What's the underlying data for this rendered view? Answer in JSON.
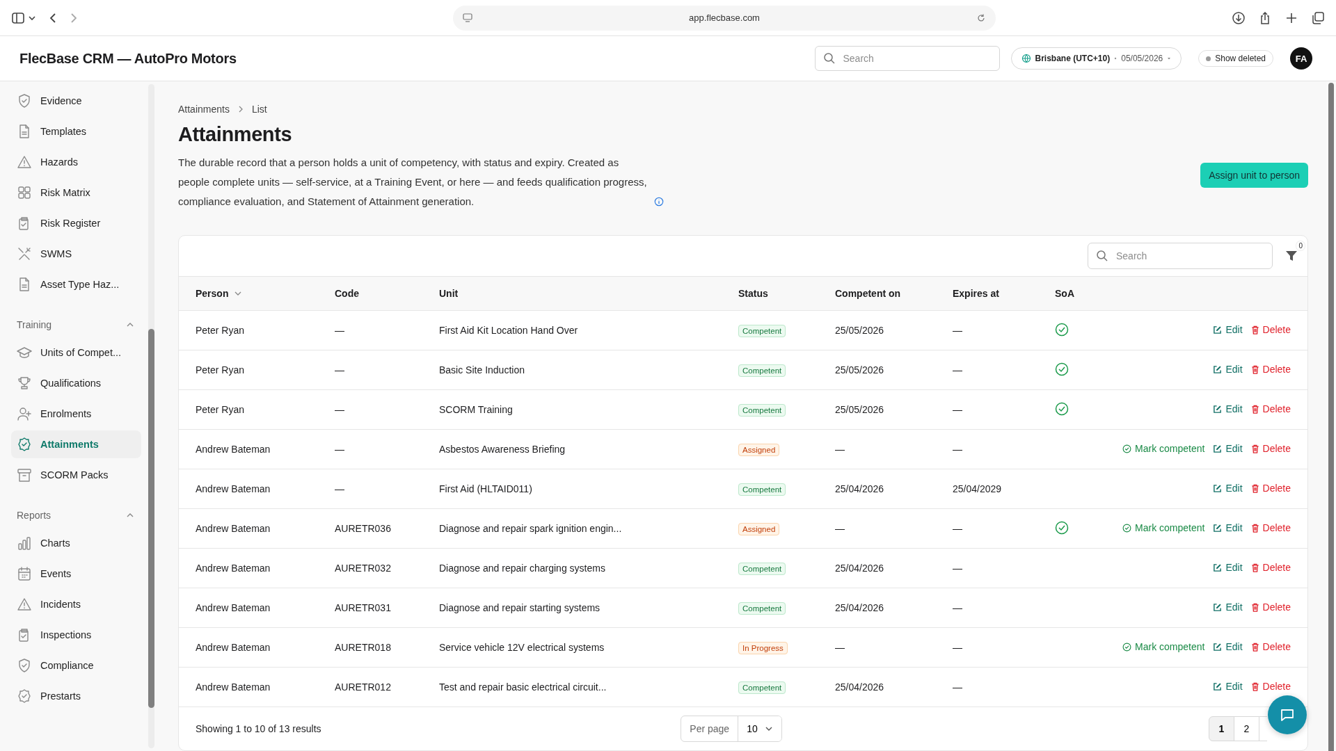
{
  "browser": {
    "url": "app.flecbase.com"
  },
  "header": {
    "title": "FlecBase CRM — AutoPro Motors",
    "search": {
      "placeholder": "Search"
    },
    "timezone": "Brisbane (UTC+10)",
    "date": "05/05/2026",
    "show_deleted": {
      "label": "Show deleted",
      "on": false
    },
    "avatar": "FA"
  },
  "sidebar": {
    "groups": [
      {
        "items": [
          {
            "label": "Evidence",
            "selected": false
          },
          {
            "label": "Templates",
            "selected": false
          },
          {
            "label": "Hazards",
            "selected": false
          },
          {
            "label": "Risk Matrix",
            "selected": false
          },
          {
            "label": "Risk Register",
            "selected": false
          },
          {
            "label": "SWMS",
            "selected": false
          },
          {
            "label": "Asset Type Haz...",
            "selected": false
          }
        ]
      },
      {
        "title": "Training",
        "expanded": true,
        "items": [
          {
            "label": "Units of Compet...",
            "selected": false
          },
          {
            "label": "Qualifications",
            "selected": false
          },
          {
            "label": "Enrolments",
            "selected": false
          },
          {
            "label": "Attainments",
            "selected": true
          },
          {
            "label": "SCORM Packs",
            "selected": false
          }
        ]
      },
      {
        "title": "Reports",
        "expanded": true,
        "items": [
          {
            "label": "Charts",
            "selected": false
          },
          {
            "label": "Events",
            "selected": false
          },
          {
            "label": "Incidents",
            "selected": false
          },
          {
            "label": "Inspections",
            "selected": false
          },
          {
            "label": "Compliance",
            "selected": false
          },
          {
            "label": "Prestarts",
            "selected": false
          }
        ]
      }
    ]
  },
  "breadcrumb": [
    "Attainments",
    "List"
  ],
  "page": {
    "title": "Attainments",
    "description": "The durable record that a person holds a unit of competency, with status and expiry. Created as people complete units — self-service, at a Training Event, or here — and feeds qualification progress, compliance evaluation, and Statement of Attainment generation.",
    "primary_button": "Assign unit to person"
  },
  "table": {
    "search": {
      "placeholder": "Search"
    },
    "filter_count": "0",
    "columns": [
      "Person",
      "Code",
      "Unit",
      "Status",
      "Competent on",
      "Expires at",
      "SoA"
    ],
    "rows": [
      {
        "person": "Peter Ryan",
        "code": "—",
        "unit": "First Aid Kit Location Hand Over",
        "status": {
          "label": "Competent",
          "kind": "competent"
        },
        "competent_on": "25/05/2026",
        "expires_at": "—",
        "soa": true,
        "actions": [
          {
            "kind": "edit",
            "label": "Edit"
          },
          {
            "kind": "delete",
            "label": "Delete"
          }
        ]
      },
      {
        "person": "Peter Ryan",
        "code": "—",
        "unit": "Basic Site Induction",
        "status": {
          "label": "Competent",
          "kind": "competent"
        },
        "competent_on": "25/05/2026",
        "expires_at": "—",
        "soa": true,
        "actions": [
          {
            "kind": "edit",
            "label": "Edit"
          },
          {
            "kind": "delete",
            "label": "Delete"
          }
        ]
      },
      {
        "person": "Peter Ryan",
        "code": "—",
        "unit": "SCORM Training",
        "status": {
          "label": "Competent",
          "kind": "competent"
        },
        "competent_on": "25/05/2026",
        "expires_at": "—",
        "soa": true,
        "actions": [
          {
            "kind": "edit",
            "label": "Edit"
          },
          {
            "kind": "delete",
            "label": "Delete"
          }
        ]
      },
      {
        "person": "Andrew Bateman",
        "code": "—",
        "unit": "Asbestos Awareness Briefing",
        "status": {
          "label": "Assigned",
          "kind": "pending"
        },
        "competent_on": "—",
        "expires_at": "—",
        "soa": false,
        "actions": [
          {
            "kind": "mark",
            "label": "Mark competent"
          },
          {
            "kind": "edit",
            "label": "Edit"
          },
          {
            "kind": "delete",
            "label": "Delete"
          }
        ]
      },
      {
        "person": "Andrew Bateman",
        "code": "—",
        "unit": "First Aid (HLTAID011)",
        "status": {
          "label": "Competent",
          "kind": "competent"
        },
        "competent_on": "25/04/2026",
        "expires_at": "25/04/2029",
        "soa": false,
        "actions": [
          {
            "kind": "edit",
            "label": "Edit"
          },
          {
            "kind": "delete",
            "label": "Delete"
          }
        ]
      },
      {
        "person": "Andrew Bateman",
        "code": "AURETR036",
        "unit": "Diagnose and repair spark ignition engin...",
        "status": {
          "label": "Assigned",
          "kind": "pending"
        },
        "competent_on": "—",
        "expires_at": "—",
        "soa": true,
        "actions": [
          {
            "kind": "mark",
            "label": "Mark competent"
          },
          {
            "kind": "edit",
            "label": "Edit"
          },
          {
            "kind": "delete",
            "label": "Delete"
          }
        ]
      },
      {
        "person": "Andrew Bateman",
        "code": "AURETR032",
        "unit": "Diagnose and repair charging systems",
        "status": {
          "label": "Competent",
          "kind": "competent"
        },
        "competent_on": "25/04/2026",
        "expires_at": "—",
        "soa": false,
        "actions": [
          {
            "kind": "edit",
            "label": "Edit"
          },
          {
            "kind": "delete",
            "label": "Delete"
          }
        ]
      },
      {
        "person": "Andrew Bateman",
        "code": "AURETR031",
        "unit": "Diagnose and repair starting systems",
        "status": {
          "label": "Competent",
          "kind": "competent"
        },
        "competent_on": "25/04/2026",
        "expires_at": "—",
        "soa": false,
        "actions": [
          {
            "kind": "edit",
            "label": "Edit"
          },
          {
            "kind": "delete",
            "label": "Delete"
          }
        ]
      },
      {
        "person": "Andrew Bateman",
        "code": "AURETR018",
        "unit": "Service vehicle 12V electrical systems",
        "status": {
          "label": "In Progress",
          "kind": "pending"
        },
        "competent_on": "—",
        "expires_at": "—",
        "soa": false,
        "actions": [
          {
            "kind": "mark",
            "label": "Mark competent"
          },
          {
            "kind": "edit",
            "label": "Edit"
          },
          {
            "kind": "delete",
            "label": "Delete"
          }
        ]
      },
      {
        "person": "Andrew Bateman",
        "code": "AURETR012",
        "unit": "Test and repair basic electrical circuit...",
        "status": {
          "label": "Competent",
          "kind": "competent"
        },
        "competent_on": "25/04/2026",
        "expires_at": "—",
        "soa": false,
        "actions": [
          {
            "kind": "edit",
            "label": "Edit"
          },
          {
            "kind": "delete",
            "label": "Delete"
          }
        ]
      }
    ],
    "footer": {
      "summary": "Showing 1 to 10 of 13 results",
      "per_page_label": "Per page",
      "per_page": "10",
      "pages": [
        {
          "label": "1",
          "selected": true
        },
        {
          "label": "2",
          "selected": false
        }
      ]
    }
  }
}
